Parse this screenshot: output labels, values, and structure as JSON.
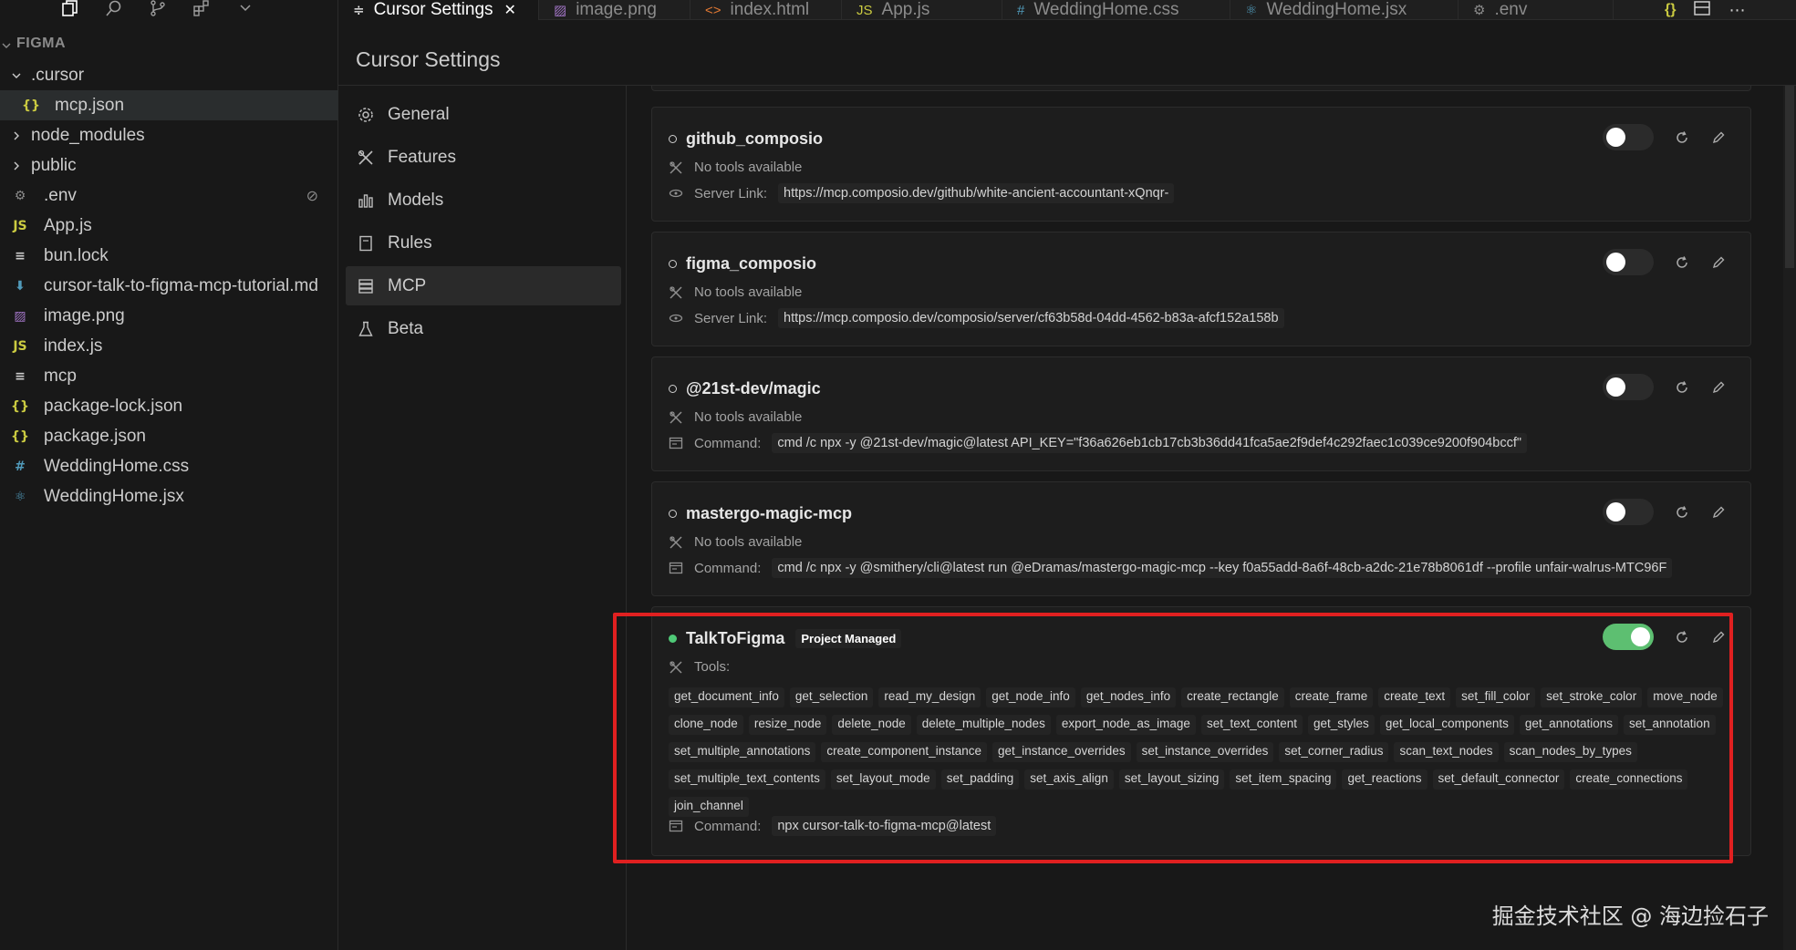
{
  "explorer": {
    "workspace_title": "FIGMA",
    "toolbar_icons": [
      "files-icon",
      "search-icon",
      "source-control-icon",
      "extensions-icon",
      "chevron-down-icon"
    ],
    "items": [
      {
        "label": ".cursor",
        "kind": "folder-open",
        "icon": "",
        "indent": 0
      },
      {
        "label": "mcp.json",
        "kind": "file",
        "icon": "{}",
        "icon_class": "json",
        "indent": 1,
        "selected": true
      },
      {
        "label": "node_modules",
        "kind": "folder",
        "icon": "",
        "indent": 0
      },
      {
        "label": "public",
        "kind": "folder",
        "icon": "",
        "indent": 0
      },
      {
        "label": ".env",
        "kind": "file",
        "icon": "⚙",
        "icon_class": "gear",
        "indent": 0,
        "ignored": true
      },
      {
        "label": "App.js",
        "kind": "file",
        "icon": "JS",
        "icon_class": "js",
        "indent": 0
      },
      {
        "label": "bun.lock",
        "kind": "file",
        "icon": "≡",
        "icon_class": "txt",
        "indent": 0
      },
      {
        "label": "cursor-talk-to-figma-mcp-tutorial.md",
        "kind": "file",
        "icon": "⬇",
        "icon_class": "md",
        "indent": 0
      },
      {
        "label": "image.png",
        "kind": "file",
        "icon": "▨",
        "icon_class": "img",
        "indent": 0
      },
      {
        "label": "index.js",
        "kind": "file",
        "icon": "JS",
        "icon_class": "js",
        "indent": 0
      },
      {
        "label": "mcp",
        "kind": "file",
        "icon": "≡",
        "icon_class": "txt",
        "indent": 0
      },
      {
        "label": "package-lock.json",
        "kind": "file",
        "icon": "{}",
        "icon_class": "json",
        "indent": 0
      },
      {
        "label": "package.json",
        "kind": "file",
        "icon": "{}",
        "icon_class": "json",
        "indent": 0
      },
      {
        "label": "WeddingHome.css",
        "kind": "file",
        "icon": "#",
        "icon_class": "css",
        "indent": 0
      },
      {
        "label": "WeddingHome.jsx",
        "kind": "file",
        "icon": "⚛",
        "icon_class": "jsx",
        "indent": 0
      }
    ]
  },
  "tabs": [
    {
      "label": "Cursor Settings",
      "icon": "≑",
      "active": true,
      "width": 220
    },
    {
      "label": "image.png",
      "icon": "▨",
      "icon_color": "#a074c4",
      "width": 166
    },
    {
      "label": "index.html",
      "icon": "<>",
      "icon_color": "#e37933",
      "width": 166
    },
    {
      "label": "App.js",
      "icon": "JS",
      "icon_color": "#cbcb41",
      "width": 176
    },
    {
      "label": "WeddingHome.css",
      "icon": "#",
      "icon_color": "#519aba",
      "width": 250
    },
    {
      "label": "WeddingHome.jsx",
      "icon": "⚛",
      "icon_color": "#519aba",
      "width": 250
    },
    {
      "label": ".env",
      "icon": "⚙",
      "icon_color": "#8a8a8a",
      "width": 170
    }
  ],
  "settings": {
    "title": "Cursor Settings",
    "nav": [
      {
        "label": "General",
        "icon": "gear-icon"
      },
      {
        "label": "Features",
        "icon": "tools-icon"
      },
      {
        "label": "Models",
        "icon": "bar-chart-icon"
      },
      {
        "label": "Rules",
        "icon": "document-icon"
      },
      {
        "label": "MCP",
        "icon": "server-icon",
        "active": true
      },
      {
        "label": "Beta",
        "icon": "flask-icon"
      }
    ]
  },
  "servers": [
    {
      "name": "github_composio",
      "enabled": false,
      "tools_text": "No tools available",
      "detail_label": "Server Link:",
      "detail_value": "https://mcp.composio.dev/github/white-ancient-accountant-xQnqr-",
      "detail_icon": "link-icon"
    },
    {
      "name": "figma_composio",
      "enabled": false,
      "tools_text": "No tools available",
      "detail_label": "Server Link:",
      "detail_value": "https://mcp.composio.dev/composio/server/cf63b58d-04dd-4562-b83a-afcf152a158b",
      "detail_icon": "link-icon"
    },
    {
      "name": "@21st-dev/magic",
      "enabled": false,
      "tools_text": "No tools available",
      "detail_label": "Command:",
      "detail_value": "cmd /c npx -y @21st-dev/magic@latest API_KEY=\"f36a626eb1cb17cb3b36dd41fca5ae2f9def4c292faec1c039ce9200f904bccf\"",
      "detail_icon": "terminal-icon"
    },
    {
      "name": "mastergo-magic-mcp",
      "enabled": false,
      "tools_text": "No tools available",
      "detail_label": "Command:",
      "detail_value": "cmd /c npx -y @smithery/cli@latest run @eDramas/mastergo-magic-mcp --key f0a55add-8a6f-48cb-a2dc-21e78b8061df --profile unfair-walrus-MTC96F",
      "detail_icon": "terminal-icon"
    },
    {
      "name": "TalkToFigma",
      "badge": "Project Managed",
      "enabled": true,
      "tools_text": "Tools:",
      "tools": [
        "get_document_info",
        "get_selection",
        "read_my_design",
        "get_node_info",
        "get_nodes_info",
        "create_rectangle",
        "create_frame",
        "create_text",
        "set_fill_color",
        "set_stroke_color",
        "move_node",
        "clone_node",
        "resize_node",
        "delete_node",
        "delete_multiple_nodes",
        "export_node_as_image",
        "set_text_content",
        "get_styles",
        "get_local_components",
        "get_annotations",
        "set_annotation",
        "set_multiple_annotations",
        "create_component_instance",
        "get_instance_overrides",
        "set_instance_overrides",
        "set_corner_radius",
        "scan_text_nodes",
        "scan_nodes_by_types",
        "set_multiple_text_contents",
        "set_layout_mode",
        "set_padding",
        "set_axis_align",
        "set_layout_sizing",
        "set_item_spacing",
        "get_reactions",
        "set_default_connector",
        "create_connections",
        "join_channel"
      ],
      "detail_label": "Command:",
      "detail_value": "npx cursor-talk-to-figma-mcp@latest",
      "detail_icon": "terminal-icon"
    }
  ],
  "watermark": "掘金技术社区 @ 海边捡石子",
  "colors": {
    "accent_toggle_on": "#5dbf71",
    "highlight_box": "#e02020",
    "status_on": "#4fc977"
  }
}
